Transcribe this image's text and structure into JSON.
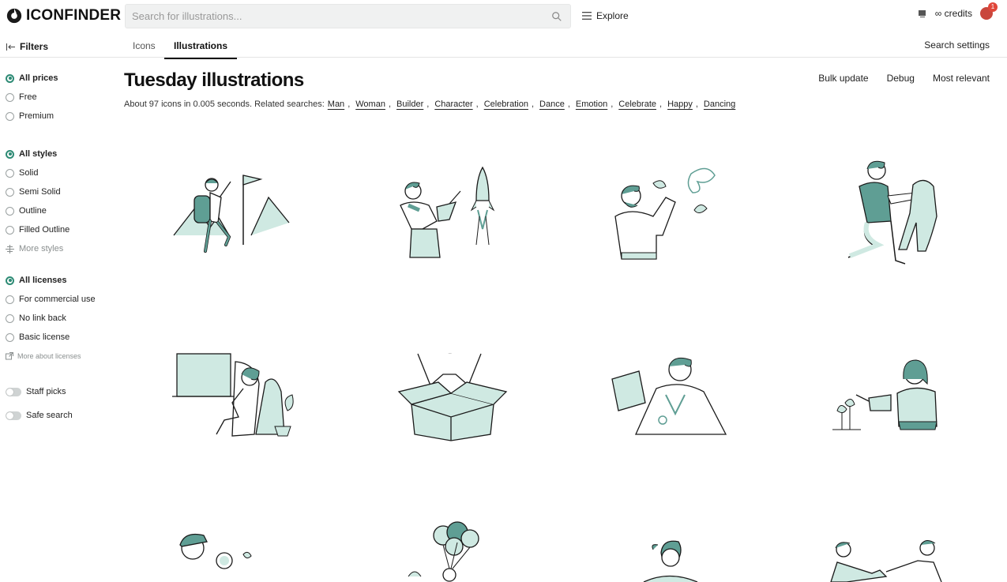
{
  "header": {
    "logo_text": "ICONFINDER",
    "search_placeholder": "Search for illustrations...",
    "explore_label": "Explore",
    "credits_label": "∞ credits",
    "notification_count": "1"
  },
  "subheader": {
    "filters_label": "Filters",
    "tabs": [
      {
        "label": "Icons"
      },
      {
        "label": "Illustrations"
      }
    ],
    "search_settings": "Search settings"
  },
  "sidebar": {
    "prices": [
      "All prices",
      "Free",
      "Premium"
    ],
    "styles": [
      "All styles",
      "Solid",
      "Semi Solid",
      "Outline",
      "Filled Outline"
    ],
    "more_styles": "More styles",
    "licenses": [
      "All licenses",
      "For commercial use",
      "No link back",
      "Basic license"
    ],
    "more_licenses": "More about licenses",
    "toggles": [
      "Staff picks",
      "Safe search"
    ]
  },
  "main": {
    "title": "Tuesday illustrations",
    "actions": [
      "Bulk update",
      "Debug",
      "Most relevant"
    ],
    "result_text": "About 97 icons in 0.005 seconds. Related searches:",
    "related": [
      "Man",
      "Woman",
      "Builder",
      "Character",
      "Celebration",
      "Dance",
      "Emotion",
      "Celebrate",
      "Happy",
      "Dancing"
    ]
  },
  "colors": {
    "accent": "#2e8b75",
    "illustration_fill": "#cfe9e2",
    "illustration_dark": "#5f9e94",
    "line": "#1a1a1a"
  },
  "illustrations": [
    {
      "icon": "hiker-reaching-flag-illustration"
    },
    {
      "icon": "man-launching-rocket-illustration"
    },
    {
      "icon": "man-with-butterflies-illustration"
    },
    {
      "icon": "man-kneeling-with-dog-illustration"
    },
    {
      "icon": "woman-relaxing-in-chair-illustration"
    },
    {
      "icon": "person-jumping-out-of-box-illustration"
    },
    {
      "icon": "doctor-with-folder-illustration"
    },
    {
      "icon": "woman-watering-flowers-illustration"
    },
    {
      "icon": "boy-with-magnifier-illustration"
    },
    {
      "icon": "person-with-balloons-illustration"
    },
    {
      "icon": "woman-with-ponytail-illustration"
    },
    {
      "icon": "two-people-handshake-illustration"
    }
  ]
}
